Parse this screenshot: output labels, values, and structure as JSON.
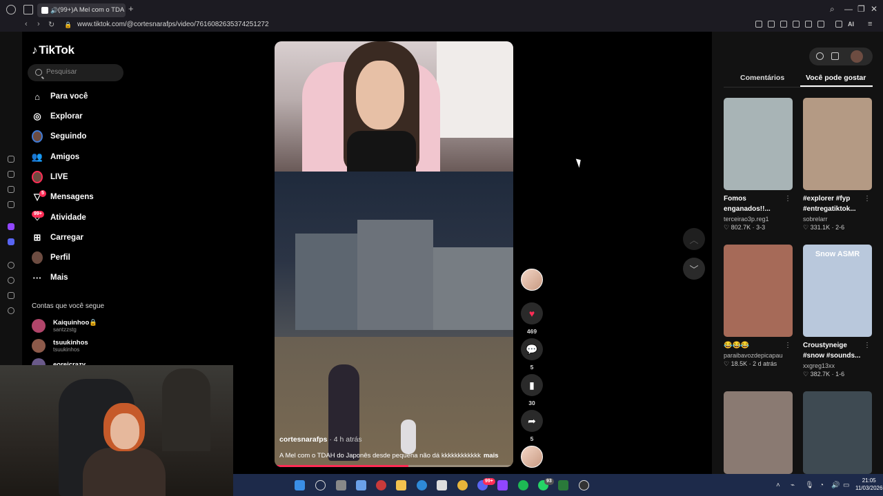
{
  "browser": {
    "tab_title": "(99+)A Mel com o TDA",
    "url": "www.tiktok.com/@cortesnarafps/video/7616082635374251272",
    "ai_label": "AI"
  },
  "tiktok": {
    "logo": "TikTok",
    "search_placeholder": "Pesquisar",
    "nav": [
      {
        "label": "Para você",
        "icon": "home-icon"
      },
      {
        "label": "Explorar",
        "icon": "compass-icon"
      },
      {
        "label": "Seguindo",
        "icon": "following-avatar-icon"
      },
      {
        "label": "Amigos",
        "icon": "friends-icon"
      },
      {
        "label": "LIVE",
        "icon": "live-icon"
      },
      {
        "label": "Mensagens",
        "icon": "messages-icon",
        "badge": "5"
      },
      {
        "label": "Atividade",
        "icon": "activity-icon",
        "badge": "99+"
      },
      {
        "label": "Carregar",
        "icon": "upload-icon"
      },
      {
        "label": "Perfil",
        "icon": "profile-avatar-icon"
      },
      {
        "label": "Mais",
        "icon": "more-icon"
      }
    ],
    "following_title": "Contas que você segue",
    "following": [
      {
        "name": "Kaiquinhoo🔒",
        "handle": "santzzstg"
      },
      {
        "name": "tsuukinhos",
        "handle": "tsuukinhos"
      },
      {
        "name": "eoreicrazy",
        "handle": ""
      }
    ]
  },
  "video": {
    "author": "cortesnarafps",
    "time": " · 4 h atrás",
    "caption": "A Mel com o TDAH do Japonês desde pequena não dá kkkkkkkkkkkk",
    "more": "mais",
    "progress": 0.56
  },
  "actions": {
    "likes": "469",
    "comments": "5",
    "saves": "30",
    "shares": "5"
  },
  "right_panel": {
    "tabs": [
      "Comentários",
      "Você pode gostar"
    ],
    "active_tab": 1,
    "cards": [
      {
        "title": "Fomos enganados!!...",
        "author": "terceirao3p.reg1",
        "likes": "802.7K",
        "meta": "3-3",
        "thumb": "#a8b4b6"
      },
      {
        "title": "#explorer #fyp #entregatiktok...",
        "author": "sobrelarr",
        "likes": "331.1K",
        "meta": "2-6",
        "thumb": "#b49a84"
      },
      {
        "title": "😂😂😂",
        "author": "paraibavozdepicapau",
        "likes": "18.5K",
        "meta": "2 d atrás",
        "thumb": "#a66a58"
      },
      {
        "title": "Croustyneige #snow #sounds...",
        "author": "xxgreg13xx",
        "likes": "382.7K",
        "meta": "1-6",
        "thumb": "#b9c8dc",
        "overlay": "Snow ASMR"
      },
      {
        "title": "",
        "author": "",
        "likes": "",
        "meta": "",
        "thumb": "#8a7a72"
      },
      {
        "title": "",
        "author": "",
        "likes": "",
        "meta": "",
        "thumb": "#3e4a52"
      }
    ]
  },
  "taskbar": {
    "time": "21:05",
    "date": "11/03/2026",
    "badges": [
      "99+",
      "93"
    ]
  }
}
